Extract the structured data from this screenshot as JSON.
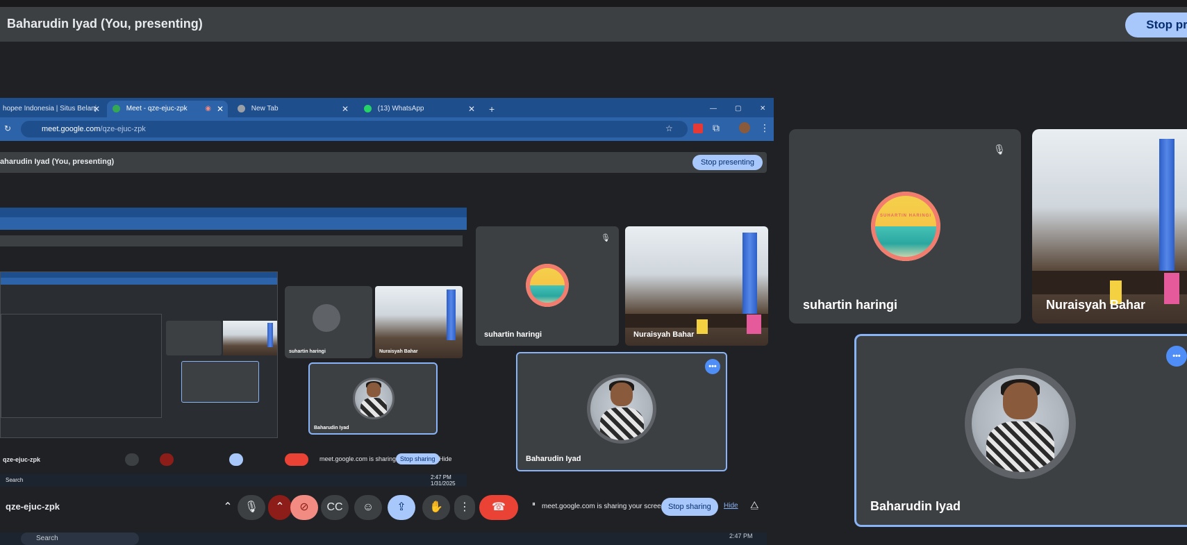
{
  "presenting_bar": {
    "title": "Baharudin Iyad (You, presenting)",
    "stop_button": "Stop pr"
  },
  "browser": {
    "tabs": [
      {
        "label": "hopee Indonesia | Situs Belanj",
        "favicon_color": "#f04e31"
      },
      {
        "label": "Meet - qze-ejuc-zpk",
        "favicon_color": "#34a853"
      },
      {
        "label": "New Tab",
        "favicon_color": "#9aa0a6"
      },
      {
        "label": "(13) WhatsApp",
        "favicon_color": "#25d366"
      }
    ],
    "new_tab_icon": "plus-icon",
    "address": {
      "host": "meet.google.com",
      "path": "/qze-ejuc-zpk"
    }
  },
  "inner_meet": {
    "presenting_title": "aharudin Iyad (You, presenting)",
    "stop_presenting": "Stop presenting",
    "tiles": [
      {
        "name": "suhartin haringi",
        "type": "logo"
      },
      {
        "name": "Nuraisyah Bahar",
        "type": "video"
      },
      {
        "name": "Baharudin Iyad",
        "type": "avatar"
      }
    ],
    "nested_names": [
      "suhartin haringi",
      "Nuraisyah Bahar",
      "Baharudin Iyad"
    ],
    "meeting_code": "qze-ejuc-zpk",
    "sharing_notice": "meet.google.com is sharing your screen.",
    "stop_sharing": "Stop sharing",
    "hide": "Hide",
    "search": "Search",
    "time": "2:47 PM",
    "date": "1/31/2025"
  },
  "right_tiles": [
    {
      "name": "suhartin haringi",
      "type": "logo"
    },
    {
      "name": "Nuraisyah Bahar",
      "type": "video"
    },
    {
      "name": "Baharudin Iyad",
      "type": "avatar"
    }
  ],
  "logo_text": "SUHARTIN HARINGI",
  "colors": {
    "accent": "#a8c7fa",
    "speaking_border": "#8ab4f8",
    "end_call": "#ea4335",
    "tile": "#3c4043"
  }
}
